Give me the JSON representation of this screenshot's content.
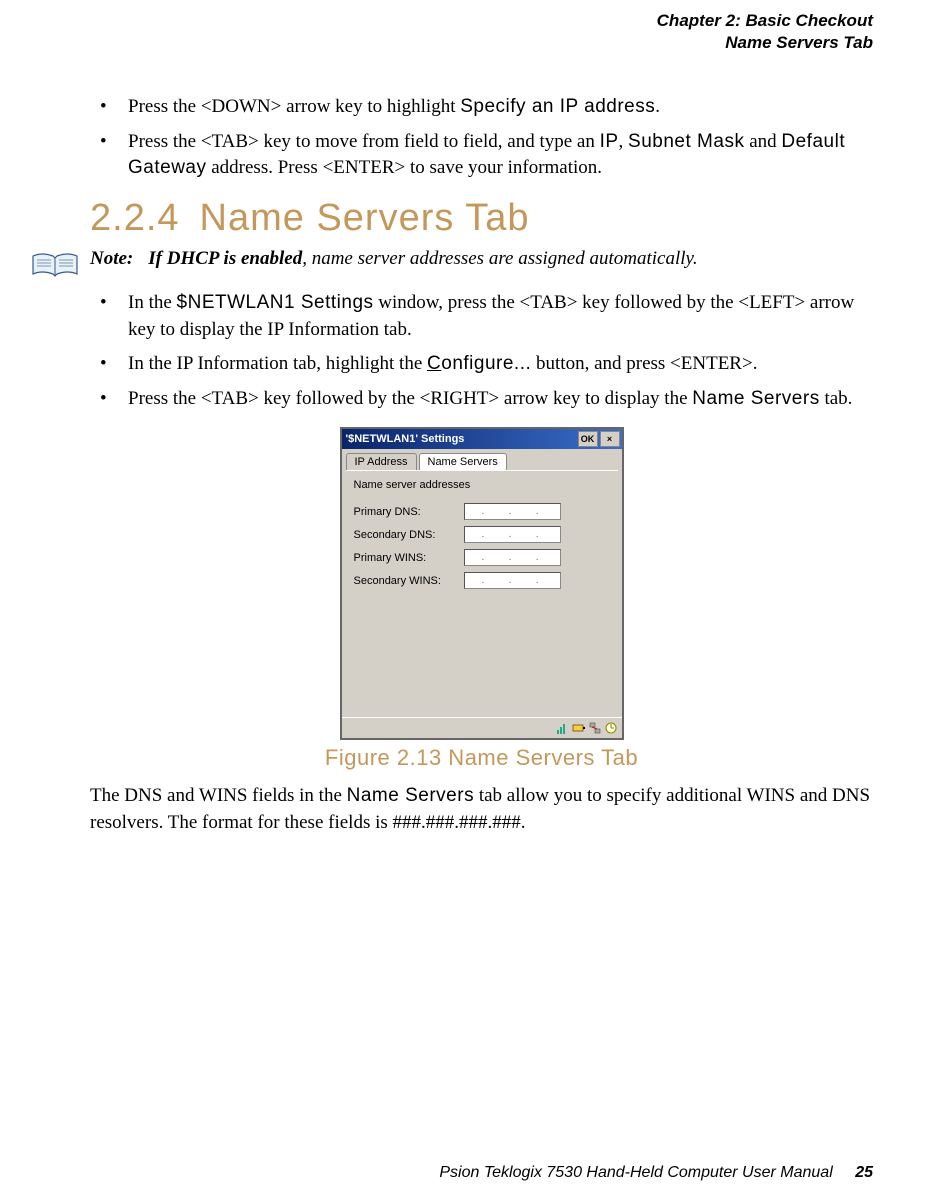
{
  "header": {
    "chapter": "Chapter  2:  Basic Checkout",
    "section": "Name Servers Tab"
  },
  "bullets_top": [
    {
      "pre": "Press the <DOWN> arrow key to highlight ",
      "special": "Specify an IP address",
      "post": "."
    },
    {
      "pre": "Press the <TAB> key to move from field to field, and type an ",
      "special1": "IP",
      "mid1": ", ",
      "special2": "Subnet Mask",
      "mid2": " and ",
      "special3": "Default Gateway",
      "post": " address. Press <ENTER> to save your information."
    }
  ],
  "section_heading": {
    "num": "2.2.4",
    "title": "Name Servers Tab"
  },
  "note": {
    "label": "Note:",
    "bold": "If DHCP is enabled",
    "rest": ", name server addresses are assigned automatically."
  },
  "bullets_mid": [
    {
      "pre": "In the ",
      "special": "$NETWLAN1 Settings",
      "post": " window, press the <TAB> key followed by the <LEFT> arrow key to display the IP Information tab."
    },
    {
      "pre": "In the IP Information tab, highlight the ",
      "special_u": "C",
      "special_rest": "onfigure...",
      "post": " button, and press <ENTER>."
    },
    {
      "pre": "Press the <TAB> key followed by the <RIGHT> arrow key to display the ",
      "special": "Name Servers",
      "post": " tab."
    }
  ],
  "screenshot": {
    "title": "'$NETWLAN1' Settings",
    "ok": "OK",
    "close": "×",
    "tabs": [
      "IP Address",
      "Name Servers"
    ],
    "body_label": "Name server addresses",
    "fields": [
      {
        "label": "Primary DNS:",
        "value": ".   .   ."
      },
      {
        "label": "Secondary DNS:",
        "value": ".   .   ."
      },
      {
        "label": "Primary WINS:",
        "value": ".   .   ."
      },
      {
        "label": "Secondary WINS:",
        "value": ".   .   ."
      }
    ]
  },
  "figure_caption": "Figure 2.13 Name Servers Tab",
  "body_para": {
    "pre": "The DNS and WINS fields in the ",
    "special": "Name Servers",
    "post": " tab allow you to specify additional WINS and DNS resolvers. The format for these fields is ###.###.###.###."
  },
  "footer": {
    "text": "Psion Teklogix 7530 Hand-Held Computer User Manual",
    "page": "25"
  }
}
